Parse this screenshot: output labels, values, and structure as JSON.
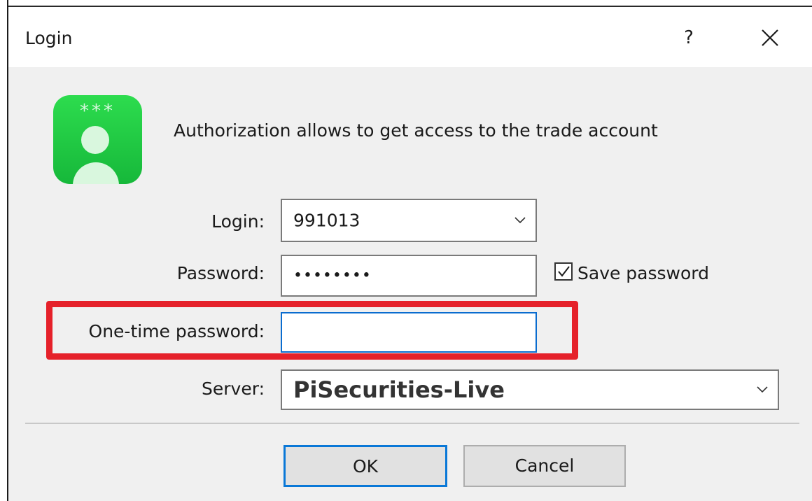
{
  "window": {
    "title": "Login",
    "help_label": "?"
  },
  "header": {
    "message": "Authorization allows to get access to the trade account",
    "icon_stars": "***"
  },
  "form": {
    "login": {
      "label": "Login:",
      "value": "991013"
    },
    "password": {
      "label": "Password:",
      "value": "••••••••"
    },
    "save_password": {
      "label": "Save password",
      "checked": true
    },
    "otp": {
      "label": "One-time password:",
      "value": ""
    },
    "server": {
      "label": "Server:",
      "value": "PiSecurities-Live"
    }
  },
  "buttons": {
    "ok": "OK",
    "cancel": "Cancel"
  },
  "colors": {
    "highlight": "#e5212a",
    "focus_border": "#0a6ccf",
    "icon_green": "#16b83a"
  }
}
